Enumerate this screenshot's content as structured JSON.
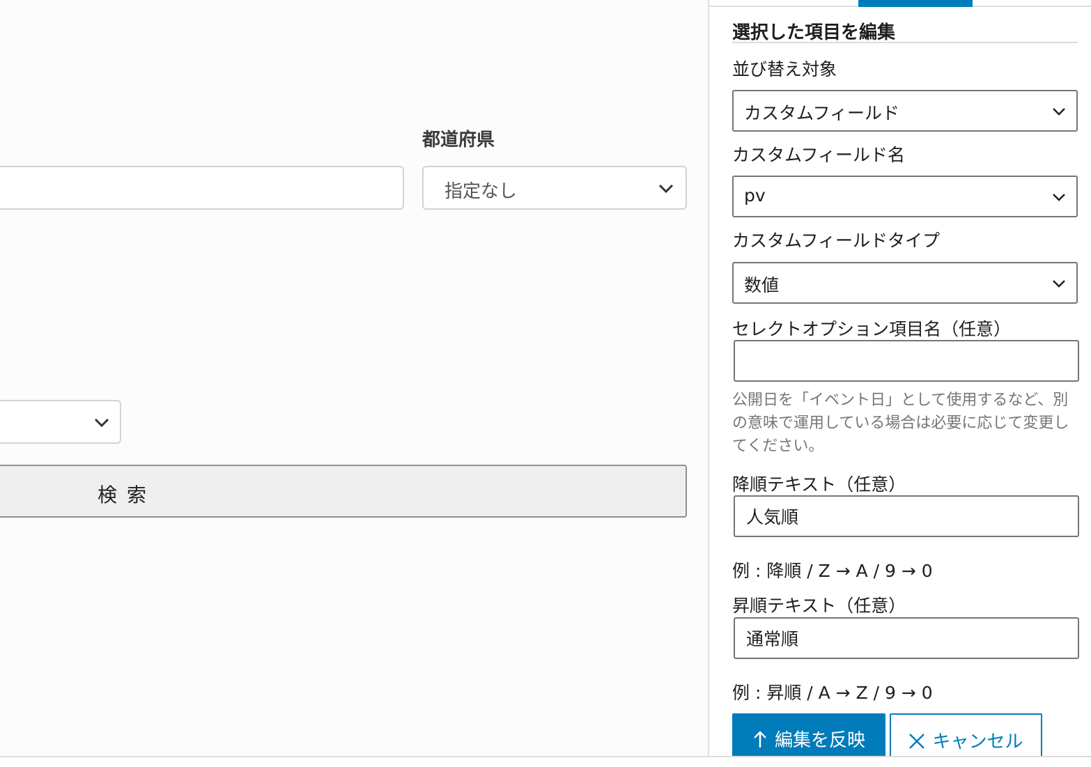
{
  "editor": {
    "prefecture_label": "都道府県",
    "prefecture_value": "指定なし",
    "search_label": "検索"
  },
  "sidebar": {
    "panel_title": "選択した項目を編集",
    "sort_target": {
      "label": "並び替え対象",
      "value": "カスタムフィールド"
    },
    "field_name": {
      "label": "カスタムフィールド名",
      "value": "pv"
    },
    "field_type": {
      "label": "カスタムフィールドタイプ",
      "value": "数値"
    },
    "option_name": {
      "label": "セレクトオプション項目名（任意）",
      "value": "",
      "help": "公開日を「イベント日」として使用するなど、別の意味で運用している場合は必要に応じて変更してください。"
    },
    "desc_text": {
      "label": "降順テキスト（任意）",
      "value": "人気順",
      "example": "例 : 降順 / Z → A / 9 → 0"
    },
    "asc_text": {
      "label": "昇順テキスト（任意）",
      "value": "通常順",
      "example": "例 : 昇順 / A → Z / 9 → 0"
    },
    "apply_label": "編集を反映",
    "cancel_label": "キャンセル",
    "accent_color": "#007cba"
  }
}
